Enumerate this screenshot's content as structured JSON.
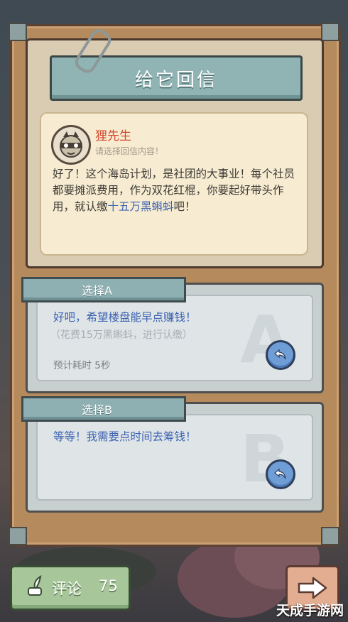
{
  "title": "给它回信",
  "letter": {
    "sender": "狸先生",
    "hint": "请选择回信内容！",
    "message_before": "好了！这个海岛计划，是社团的大事业！每个社员都要摊派费用，作为双花红棍，你要起好带头作用，就认缴",
    "message_highlight": "十五万黑蝌蚪",
    "message_after": "吧！"
  },
  "choices": [
    {
      "label": "选择A",
      "letter": "A",
      "text": "好吧，希望楼盘能早点赚钱！",
      "sub": "（花费15万黑蝌蚪，进行认缴）",
      "time": "预计耗时 5秒"
    },
    {
      "label": "选择B",
      "letter": "B",
      "text": "等等！我需要点时间去筹钱！"
    }
  ],
  "footer": {
    "comment_label": "评论",
    "comment_count": "75"
  },
  "watermark": "天成手游网",
  "icons": {
    "avatar": "raccoon-avatar-icon",
    "reply": "reply-arrow-icon",
    "comment": "quill-icon",
    "next": "arrow-right-icon"
  },
  "colors": {
    "title_banner": "#90b3b3",
    "sender": "#d24a2f",
    "highlight": "#3d63b4",
    "comment_button": "#a7c79a",
    "next_button": "#e3ad92"
  }
}
